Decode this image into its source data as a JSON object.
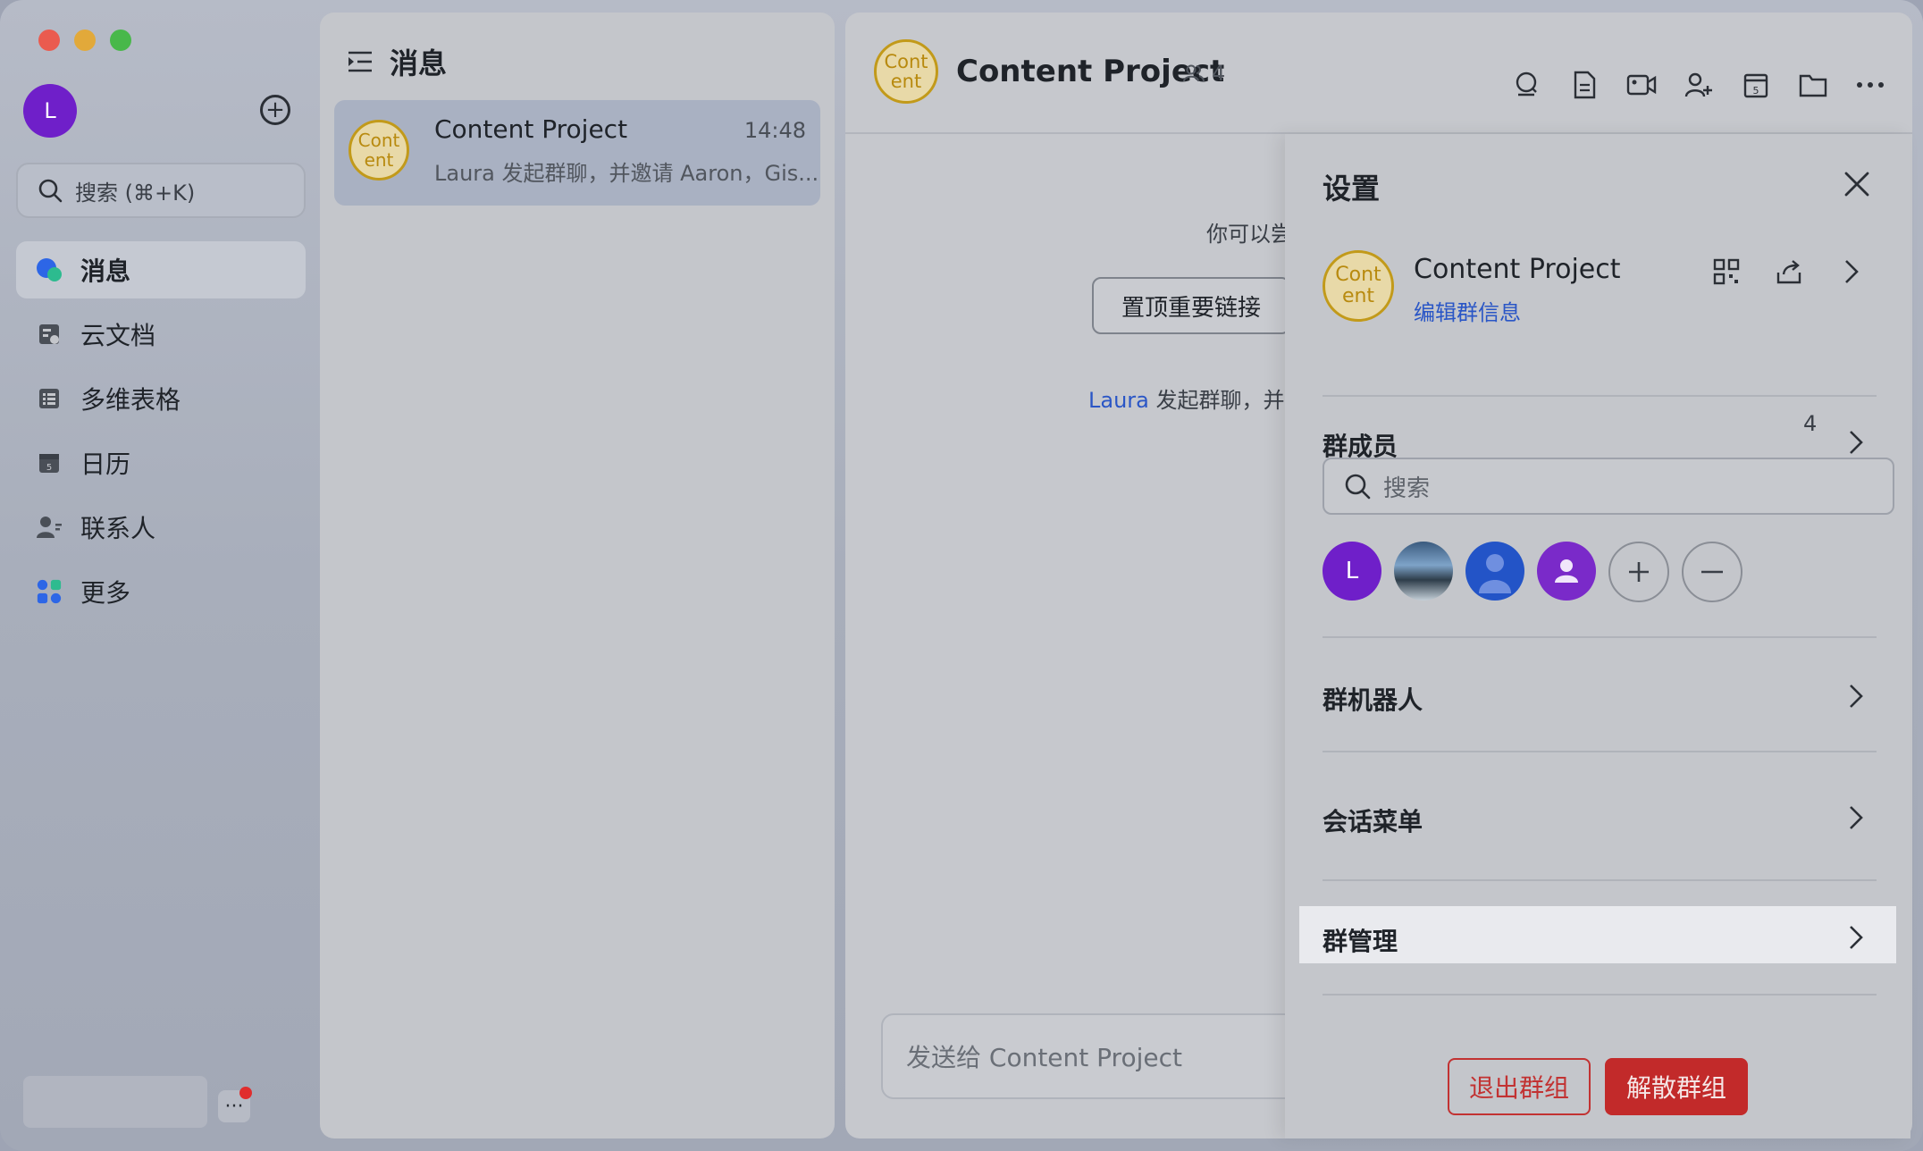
{
  "sidebar": {
    "avatar_letter": "L",
    "search_placeholder": "搜索 (⌘+K)",
    "items": [
      {
        "label": "消息",
        "icon": "chat-bubble-icon"
      },
      {
        "label": "云文档",
        "icon": "cloud-doc-icon"
      },
      {
        "label": "多维表格",
        "icon": "table-icon"
      },
      {
        "label": "日历",
        "icon": "calendar-icon"
      },
      {
        "label": "联系人",
        "icon": "contacts-icon"
      },
      {
        "label": "更多",
        "icon": "apps-icon"
      }
    ],
    "more_label": "···"
  },
  "message_list": {
    "title": "消息",
    "conversations": [
      {
        "avatar_text": "Cont ent",
        "title": "Content Project",
        "time": "14:48",
        "preview": "Laura 发起群聊，并邀请 Aaron，Gis..."
      }
    ]
  },
  "chat": {
    "avatar_text": "Cont ent",
    "title": "Content Project",
    "member_count": "4",
    "hint": "你可以尝",
    "pin_button": "置顶重要链接",
    "system_message": {
      "name": "Laura",
      "text": " 发起群聊，并"
    },
    "composer_placeholder": "发送给 Content Project"
  },
  "settings": {
    "title": "设置",
    "group_avatar_text": "Cont ent",
    "group_name": "Content Project",
    "edit_info": "编辑群信息",
    "members_label": "群成员",
    "members_count": "4",
    "member_search_placeholder": "搜索",
    "members": [
      {
        "letter": "L"
      },
      {
        "letter": ""
      },
      {
        "letter": ""
      },
      {
        "letter": ""
      }
    ],
    "bots_label": "群机器人",
    "session_menu_label": "会话菜单",
    "management_label": "群管理",
    "exit_button": "退出群组",
    "dissolve_button": "解散群组"
  },
  "colors": {
    "accent_link": "#2a56c6",
    "danger": "#c22a2a",
    "avatar_gold": "#c29a1a",
    "avatar_purple": "#6f1fc9"
  }
}
